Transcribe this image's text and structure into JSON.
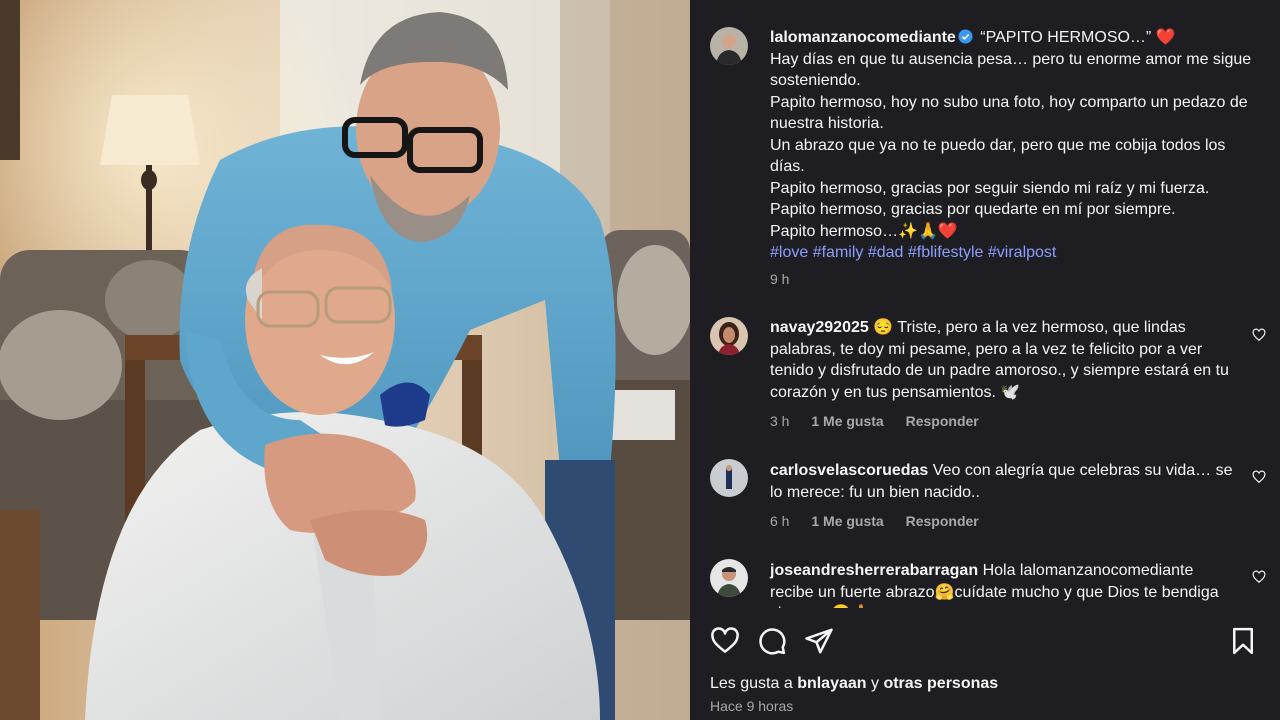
{
  "post": {
    "author": "lalomanzanocomediante",
    "title": "“PAPITO HERMOSO…”",
    "title_heart": "❤️",
    "lines": [
      "Hay días en que tu ausencia pesa… pero tu enorme amor me sigue sosteniendo.",
      "Papito hermoso, hoy no subo una foto, hoy comparto un pedazo de nuestra historia.",
      "Un abrazo que ya no te puedo dar, pero que me cobija todos los días.",
      "Papito hermoso, gracias por seguir siendo mi raíz y mi fuerza.",
      "Papito hermoso, gracias por quedarte en mí por siempre.",
      "Papito hermoso…✨🙏❤️"
    ],
    "hashtags": "#love #family #dad #fblifestyle #viralpost",
    "time": "9 h"
  },
  "comments": [
    {
      "user": "navay292025",
      "emoji": "😔",
      "text": "Triste, pero a la vez hermoso, que lindas palabras, te doy mi pesame, pero a la vez te felicito por a ver tenido y disfrutado de un padre amoroso., y siempre estará en tu corazón y en tus pensamientos. 🕊️",
      "time": "3 h",
      "likes": "1 Me gusta",
      "reply": "Responder"
    },
    {
      "user": "carlosvelascoruedas",
      "emoji": "",
      "text": "Veo con alegría que celebras su vida… se lo merece: fu un bien nacido..",
      "time": "6 h",
      "likes": "1 Me gusta",
      "reply": "Responder"
    },
    {
      "user": "joseandresherrerabarragan",
      "emoji": "",
      "text": "Hola lalomanzanocomediante recibe un fuerte abrazo🤗cuídate mucho y que Dios te bendiga siempre 😊🙏",
      "time": "",
      "likes": "",
      "reply": ""
    }
  ],
  "footer": {
    "likes_prefix": "Les gusta a",
    "likes_user": "bnlayaan",
    "likes_mid": "y",
    "likes_others": "otras personas",
    "ago": "Hace 9 horas"
  },
  "icons": {
    "like": "heart-icon",
    "comment": "comment-bubble-icon",
    "share": "paper-plane-icon",
    "save": "bookmark-icon",
    "verified": "verified-badge-icon"
  },
  "colors": {
    "panel_bg": "#1e1e22",
    "hashtag": "#8c9eff",
    "verified": "#3897f0",
    "muted": "#a8a8a8"
  }
}
